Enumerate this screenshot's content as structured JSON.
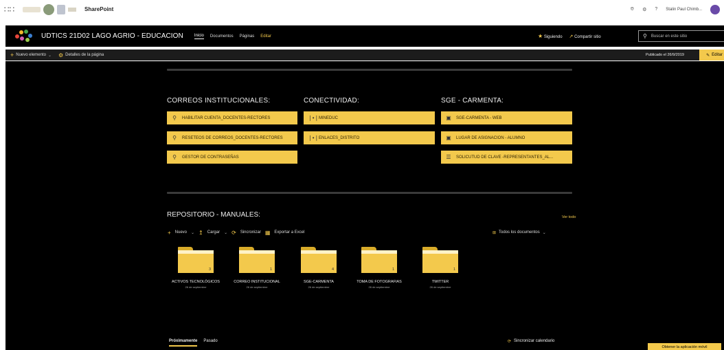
{
  "suite": {
    "app_name": "SharePoint",
    "user_name": "Stalin Paul Chimb...",
    "waffle_icon": "waffle-icon",
    "bell_icon": "bell-icon",
    "settings_icon": "gear-icon",
    "help_text": "?"
  },
  "site": {
    "title": "UDTICS 21D02 LAGO AGRIO - EDUCACION",
    "nav": [
      "Inicio",
      "Documentos",
      "Páginas",
      "Editar"
    ],
    "following": "Siguiendo",
    "share": "Compartir sitio",
    "search_placeholder": "Buscar en este sitio"
  },
  "command": {
    "new_item": "Nuevo elemento",
    "page_details": "Detalles de la página",
    "published": "Publicado el 26/9/2019",
    "edit": "Editar"
  },
  "columns": [
    {
      "title": "CORREOS INSTITUCIONALES:",
      "links": [
        {
          "label": "HABILITAR CUENTA_DOCENTES-RECTORES",
          "icon": "person-icon"
        },
        {
          "label": "RESETEOS DE CORREOS_DOCENTES-RECTORES",
          "icon": "person-edit-icon"
        },
        {
          "label": "GESTOR DE CONTRASEÑAS",
          "icon": "person-key-icon"
        }
      ]
    },
    {
      "title": "CONECTIVIDAD:",
      "links": [
        {
          "label": "MINEDUC",
          "icon": "broadcast-icon"
        },
        {
          "label": "ENLACES_DISTRITO",
          "icon": "broadcast-icon"
        }
      ]
    },
    {
      "title": "SGE - CARMENTA:",
      "links": [
        {
          "label": "SGE-CARMENTA - WEB",
          "icon": "browser-icon"
        },
        {
          "label": "LUGAR DE ASIGNACION - ALUMNO",
          "icon": "browser-icon"
        },
        {
          "label": "SOLICUTUD DE CLAVE -REPRESENTANTES_AL...",
          "icon": "list-icon"
        }
      ]
    }
  ],
  "repo": {
    "title": "REPOSITORIO - MANUALES:",
    "see_all": "Ver todo",
    "commands": [
      "Nuevo",
      "Cargar",
      "Sincronizar",
      "Exportar a Excel"
    ],
    "view": "Todos los documentos",
    "folders": [
      {
        "name": "ACTIVOS TECNOLÓGICOS",
        "date": "26 de septiembre",
        "count": "3"
      },
      {
        "name": "CORREO INSTITUCIONAL",
        "date": "26 de septiembre",
        "count": "1"
      },
      {
        "name": "SGE-CARMENTA",
        "date": "26 de septiembre",
        "count": "4"
      },
      {
        "name": "TOMA DE FOTOGRAFIAS",
        "date": "26 de septiembre",
        "count": "1"
      },
      {
        "name": "TWITTER",
        "date": "26 de septiembre",
        "count": "1"
      }
    ]
  },
  "events": {
    "tabs": [
      "Próximamente",
      "Pasado"
    ],
    "sync": "Sincronizar calendario"
  },
  "get_app": "Obtener la aplicación móvil",
  "colors": {
    "accent": "#f3c94c",
    "background": "#000000"
  }
}
